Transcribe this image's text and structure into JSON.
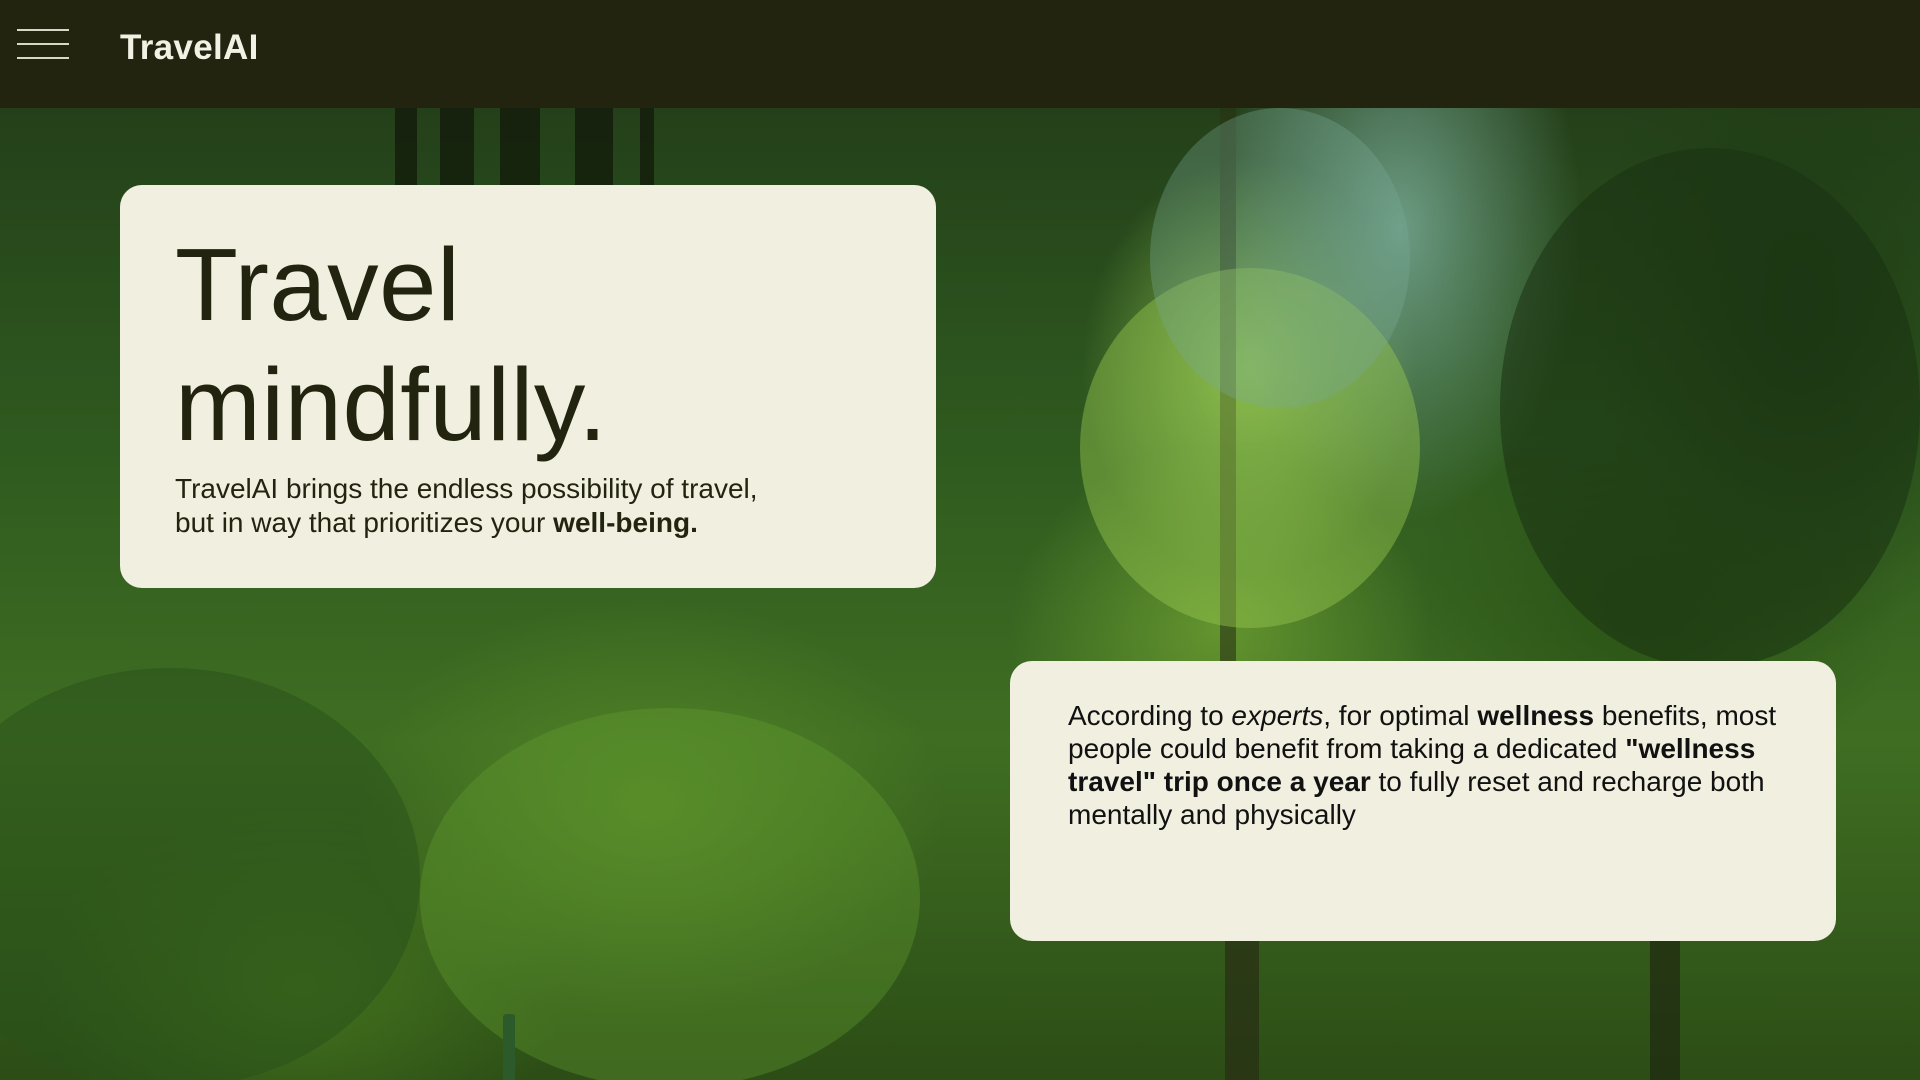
{
  "header": {
    "menu_icon": "hamburger-menu-icon",
    "brand": "TravelAI"
  },
  "hero": {
    "headline_line1": "Travel",
    "headline_line2": "mindfully.",
    "sub_line1": "TravelAI brings the endless possibility of travel,",
    "sub_line2_prefix": "but in way that prioritizes your ",
    "sub_line2_bold": "well-being."
  },
  "info": {
    "p1": "According to ",
    "p1_italic": "experts",
    "p2": ", for optimal ",
    "p2_bold": "wellness",
    "p3": " benefits, most people could benefit from taking a dedicated ",
    "p3_bold": "\"wellness travel\" trip once a year",
    "p4": " to fully reset and recharge both mentally and physically"
  },
  "colors": {
    "topbar": "#222410",
    "card": "#f1efe0",
    "text_dark": "#222410",
    "brand_text": "#f3f1e4"
  }
}
